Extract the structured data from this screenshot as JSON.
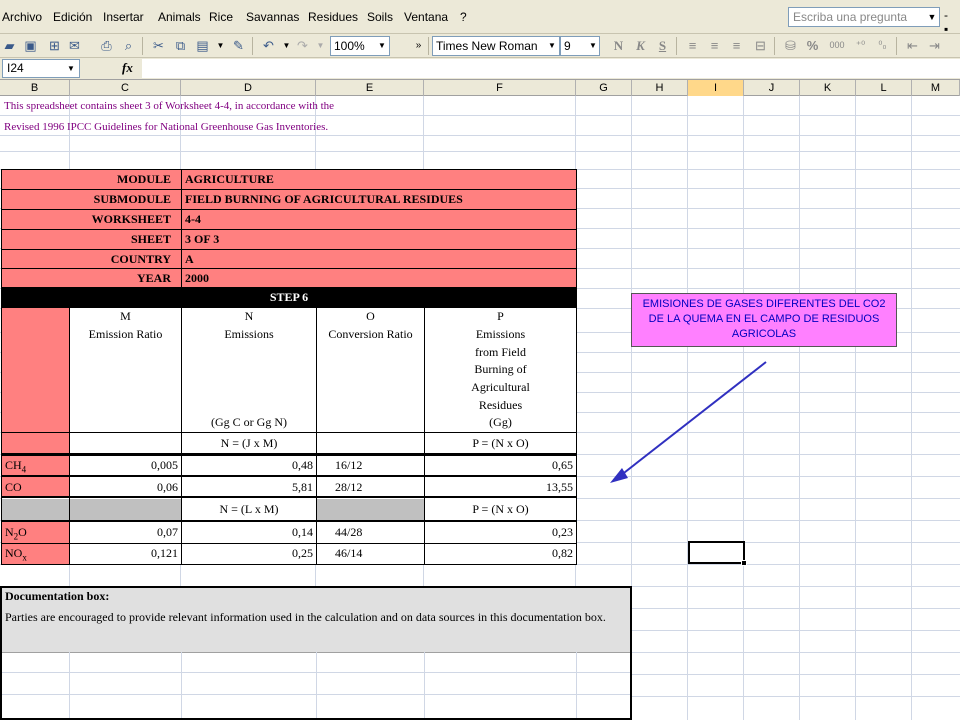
{
  "menu": {
    "items": [
      "Archivo",
      "Edición",
      "Insertar",
      "Animals",
      "Rice",
      "Savannas",
      "Residues",
      "Soils",
      "Ventana",
      "?"
    ],
    "help_placeholder": "Escriba una pregunta"
  },
  "toolbar": {
    "zoom": "100%",
    "font_name": "Times New Roman",
    "font_size": "9",
    "bold": "N",
    "italic": "K",
    "underline": "S",
    "percent": "%",
    "thousands": "000"
  },
  "formula_bar": {
    "cell_ref": "I24",
    "fx": "fx",
    "value": ""
  },
  "columns": [
    "B",
    "C",
    "D",
    "E",
    "F",
    "G",
    "H",
    "I",
    "J",
    "K",
    "L",
    "M"
  ],
  "selected_column": "I",
  "intro": {
    "line1": "This spreadsheet contains sheet 3 of Worksheet 4-4, in accordance with the",
    "line2": "Revised 1996 IPCC Guidelines for National Greenhouse Gas Inventories."
  },
  "header_rows": [
    {
      "label": "MODULE",
      "value": "AGRICULTURE"
    },
    {
      "label": "SUBMODULE",
      "value": "FIELD BURNING OF AGRICULTURAL RESIDUES"
    },
    {
      "label": "WORKSHEET",
      "value": "4-4"
    },
    {
      "label": "SHEET",
      "value": "3 OF 3"
    },
    {
      "label": "COUNTRY",
      "value": "A"
    },
    {
      "label": "YEAR",
      "value": "2000"
    }
  ],
  "step": "STEP 6",
  "col_heads": {
    "m_letter": "M",
    "m_title": "Emission Ratio",
    "n_letter": "N",
    "n_title": "Emissions",
    "n_unit": "(Gg C or Gg N)",
    "o_letter": "O",
    "o_title": "Conversion Ratio",
    "p_letter": "P",
    "p_title_lines": [
      "Emissions",
      "from Field",
      "Burning of",
      "Agricultural",
      "Residues",
      "(Gg)"
    ]
  },
  "formulas": {
    "n1": "N = (J x M)",
    "p1": "P = (N x O)",
    "n2": "N = (L x M)",
    "p2": "P = (N x O)"
  },
  "rows_carbon": [
    {
      "gas": "CH",
      "sub": "4",
      "m": "0,005",
      "n": "0,48",
      "o": "16/12",
      "p": "0,65"
    },
    {
      "gas": "CO",
      "sub": "",
      "m": "0,06",
      "n": "5,81",
      "o": "28/12",
      "p": "13,55"
    }
  ],
  "rows_nitrogen": [
    {
      "gas": "N",
      "sub": "2",
      "tail": "O",
      "m": "0,07",
      "n": "0,14",
      "o": "44/28",
      "p": "0,23"
    },
    {
      "gas": "NO",
      "sub": "x",
      "tail": "",
      "m": "0,121",
      "n": "0,25",
      "o": "46/14",
      "p": "0,82"
    }
  ],
  "callout": "EMISIONES DE GASES DIFERENTES DEL CO2 DE LA QUEMA EN EL CAMPO DE RESIDUOS AGRICOLAS",
  "documentation": {
    "title": "Documentation box:",
    "text": "Parties are encouraged to provide relevant information used in the calculation and on data sources in this documentation box."
  },
  "colors": {
    "header_fill": "#ff8080",
    "callout_fill": "#ff80ff",
    "callout_text": "#0000c0",
    "arrow": "#3030c0",
    "intro_text": "#800080"
  }
}
